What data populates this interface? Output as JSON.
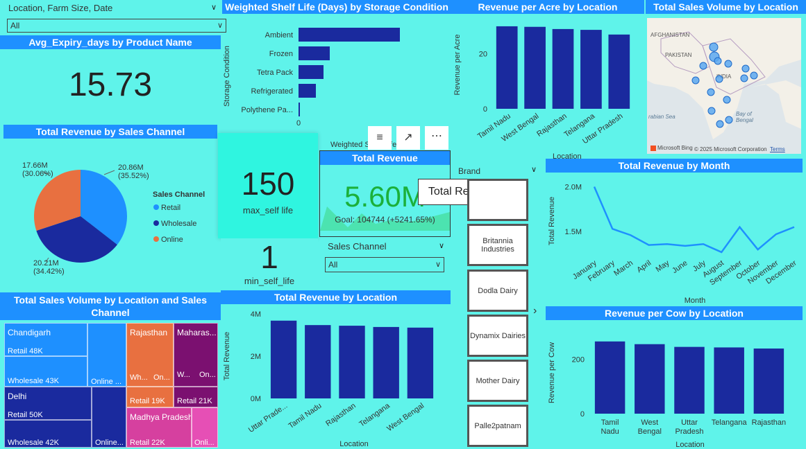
{
  "filter_slicer": {
    "title": "Location, Farm Size, Date",
    "value": "All"
  },
  "avg_expiry": {
    "title": "Avg_Expiry_days by Product Name",
    "value": "15.73"
  },
  "shelf_life_chart": {
    "title": "Weighted Shelf Life (Days) by Storage Condition",
    "ylabel": "Storage Condition",
    "xlabel": "Weighted Shelf Life",
    "zero_tick": "0"
  },
  "revenue_per_acre": {
    "title": "Revenue per Acre by Location",
    "ylabel": "Revenue per Acre",
    "xlabel": "Location"
  },
  "sales_volume_map": {
    "title": "Total Sales Volume by Location",
    "copyright": "© 2025 Microsoft Corporation",
    "terms": "Terms",
    "bing": "Microsoft Bing",
    "labels": {
      "afghanistan": "AFGHANISTAN",
      "pakistan": "PAKISTAN",
      "india": "INDIA",
      "arabian": "rabian Sea",
      "bay": "Bay of Bengal"
    }
  },
  "sales_channel_pie": {
    "title": "Total Revenue by Sales Channel",
    "legend_title": "Sales Channel",
    "slices": [
      {
        "name": "Retail",
        "label": "20.86M",
        "pct": "(35.52%)",
        "color": "#1e90ff"
      },
      {
        "name": "Wholesale",
        "label": "20.21M",
        "pct": "(34.42%)",
        "color": "#1a2a9e"
      },
      {
        "name": "Online",
        "label": "17.66M",
        "pct": "(30.06%)",
        "color": "#e87040"
      }
    ]
  },
  "max_self_life": {
    "value": "150",
    "label": "max_self life"
  },
  "min_self_life": {
    "value": "1",
    "label": "min_self_life"
  },
  "total_revenue_kpi": {
    "title": "Total Revenue",
    "value": "5.60M",
    "goal": "Goal: 104744 (+5241.65%)"
  },
  "tooltip": {
    "text": "Total Revenue"
  },
  "brand_slicer": {
    "title": "Brand",
    "items": [
      "Britannia Industries",
      "Dodla Dairy",
      "Dynamix Dairies",
      "Mother Dairy",
      "Palle2patnam"
    ]
  },
  "sales_channel_slicer": {
    "title": "Sales Channel",
    "value": "All"
  },
  "revenue_by_month": {
    "title": "Total Revenue by Month",
    "ylabel": "Total Revenue",
    "xlabel": "Month"
  },
  "treemap": {
    "title": "Total Sales Volume by Location and Sales Channel",
    "cells": {
      "chandigarh": "Chandigarh",
      "chandigarh_retail": "Retail 48K",
      "chandigarh_wholesale": "Wholesale 43K",
      "chandigarh_online": "Online ...",
      "delhi": "Delhi",
      "delhi_retail": "Retail 50K",
      "delhi_wholesale": "Wholesale 42K",
      "delhi_online": "Online...",
      "rajasthan": "Rajasthan",
      "rajasthan_wh": "Wh...",
      "rajasthan_on": "On...",
      "rajasthan_retail": "Retail 19K",
      "maharashtra": "Maharas...",
      "maharashtra_w": "W...",
      "maharashtra_on": "On...",
      "maharashtra_retail": "Retail 21K",
      "madhya": "Madhya Pradesh",
      "madhya_retail": "Retail 22K",
      "madhya_onli": "Onli..."
    }
  },
  "revenue_by_location": {
    "title": "Total Revenue by Location",
    "ylabel": "Total Revenue",
    "xlabel": "Location"
  },
  "revenue_per_cow": {
    "title": "Revenue per Cow by Location",
    "ylabel": "Revenue per Cow",
    "xlabel": "Location"
  },
  "chart_data": [
    {
      "type": "bar",
      "orientation": "horizontal",
      "title": "Weighted Shelf Life (Days) by Storage Condition",
      "categories": [
        "Ambient",
        "Frozen",
        "Tetra Pack",
        "Refrigerated",
        "Polythene Pa..."
      ],
      "values": [
        146,
        45,
        36,
        25,
        2
      ],
      "xlim": [
        0,
        150
      ],
      "ylabel": "Storage Condition",
      "xlabel": "Weighted Shelf Life",
      "color": "#1a2a9e"
    },
    {
      "type": "bar",
      "title": "Revenue per Acre by Location",
      "categories": [
        "Tamil Nadu",
        "West Bengal",
        "Rajasthan",
        "Telangana",
        "Uttar Pradesh"
      ],
      "values": [
        30,
        29.8,
        29,
        28.7,
        27
      ],
      "ylim": [
        0,
        32
      ],
      "yticks": [
        0,
        20
      ],
      "ylabel": "Revenue per Acre",
      "xlabel": "Location",
      "color": "#1a2a9e"
    },
    {
      "type": "pie",
      "title": "Total Revenue by Sales Channel",
      "categories": [
        "Retail",
        "Wholesale",
        "Online"
      ],
      "values": [
        20.86,
        20.21,
        17.66
      ]
    },
    {
      "type": "line",
      "title": "Total Revenue by Month",
      "categories": [
        "January",
        "February",
        "March",
        "April",
        "May",
        "June",
        "July",
        "August",
        "September",
        "October",
        "November",
        "December"
      ],
      "values": [
        2.0,
        1.53,
        1.46,
        1.35,
        1.36,
        1.34,
        1.36,
        1.27,
        1.55,
        1.3,
        1.47,
        1.55
      ],
      "ylim": [
        1.2,
        2.05
      ],
      "yticks": [
        1.5,
        2.0
      ],
      "ytick_labels": [
        "1.5M",
        "2.0M"
      ],
      "ylabel": "Total Revenue",
      "xlabel": "Month",
      "color": "#1e90ff"
    },
    {
      "type": "bar",
      "title": "Total Revenue by Location",
      "categories": [
        "Uttar Prade...",
        "Tamil Nadu",
        "Rajasthan",
        "Telangana",
        "West Bengal"
      ],
      "values": [
        3.68,
        3.47,
        3.44,
        3.38,
        3.35
      ],
      "ylim": [
        0,
        4
      ],
      "yticks": [
        0,
        2,
        4
      ],
      "ytick_labels": [
        "0M",
        "2M",
        "4M"
      ],
      "ylabel": "Total Revenue",
      "xlabel": "Location",
      "color": "#1a2a9e"
    },
    {
      "type": "bar",
      "title": "Revenue per Cow by Location",
      "categories": [
        "Tamil Nadu",
        "West Bengal",
        "Uttar Pradesh",
        "Telangana",
        "Rajasthan"
      ],
      "values": [
        265,
        255,
        245,
        243,
        239
      ],
      "ylim": [
        0,
        300
      ],
      "yticks": [
        0,
        200
      ],
      "ylabel": "Revenue per Cow",
      "xlabel": "Location",
      "color": "#1a2a9e"
    }
  ]
}
